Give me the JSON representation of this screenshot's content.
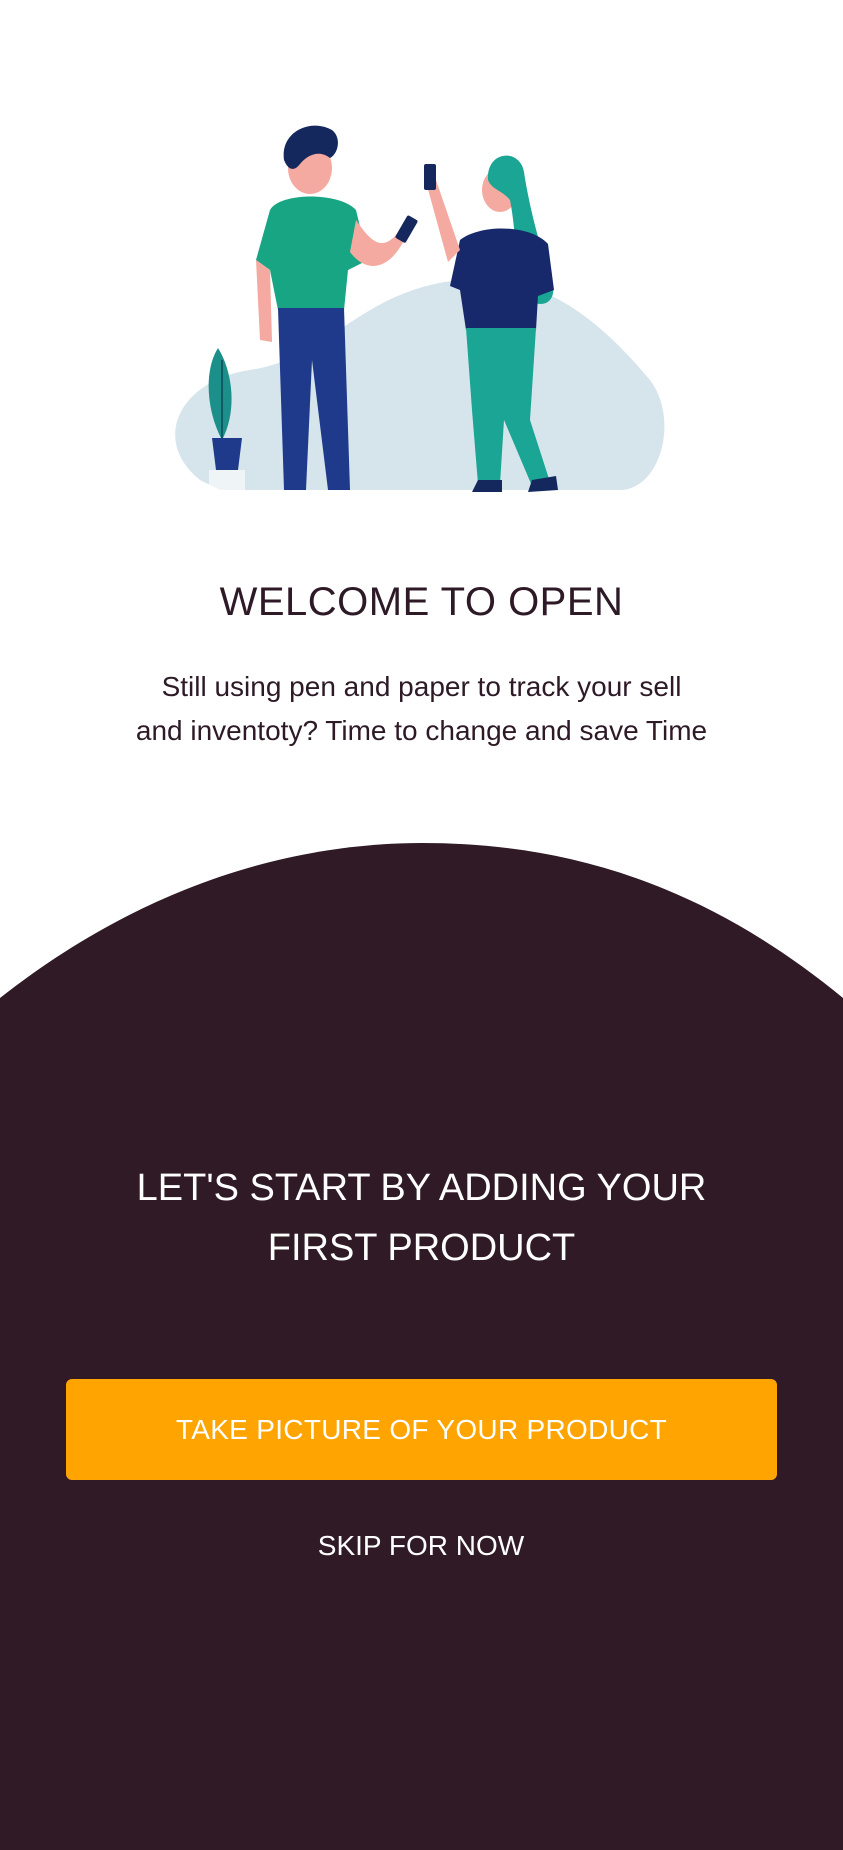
{
  "welcome": {
    "title": "WELCOME TO OPEN",
    "description_line1": "Still using pen and paper to track your sell",
    "description_line2": "and inventoty? Time to change and save Time"
  },
  "onboarding": {
    "heading_line1": "LET'S START BY ADDING YOUR",
    "heading_line2": "FIRST PRODUCT",
    "primary_button_label": "TAKE PICTURE OF YOUR PRODUCT",
    "skip_label": "SKIP FOR NOW"
  },
  "colors": {
    "background": "#ffffff",
    "panel": "#2f1a25",
    "accent": "#ffa400",
    "title_text": "#2d1a26"
  },
  "illustration": {
    "icon_name": "two-people-with-phones-illustration"
  }
}
